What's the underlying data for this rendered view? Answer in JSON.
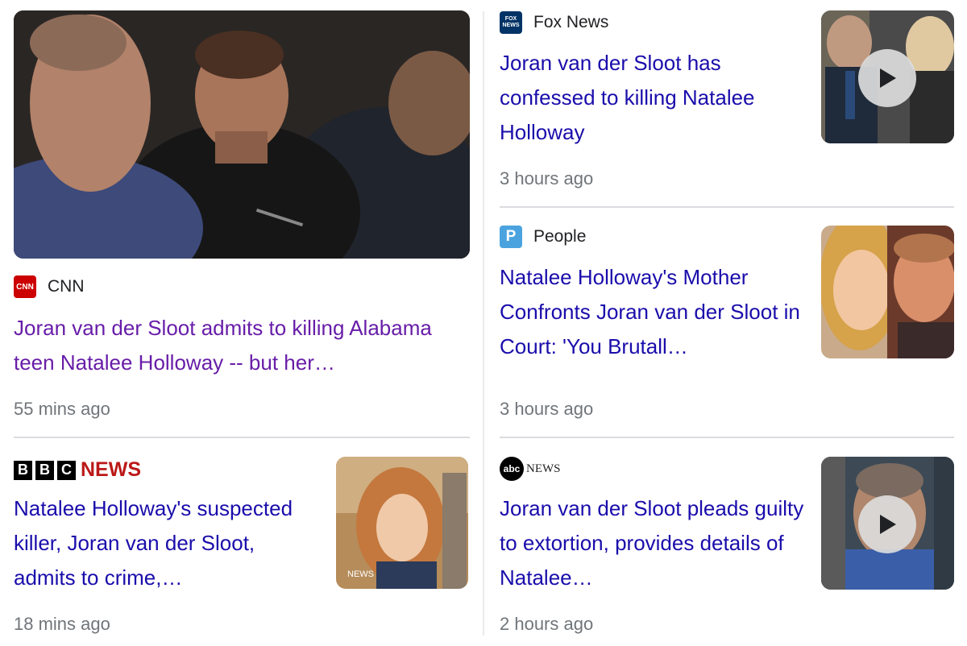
{
  "articles": [
    {
      "source": "CNN",
      "headline": "Joran van der Sloot admits to killing Alabama teen Natalee Holloway -- but her…",
      "time": "55 mins ago",
      "has_video": false,
      "visited": true,
      "logo_icon": "cnn-logo-icon",
      "logo_text": "CNN",
      "logo_color": "#cc0000"
    },
    {
      "source": "Fox News",
      "headline": "Joran van der Sloot has confessed to killing Natalee Holloway",
      "time": "3 hours ago",
      "has_video": true,
      "logo_icon": "fox-news-logo-icon",
      "logo_text": "FOX NEWS",
      "logo_color": "#003366"
    },
    {
      "source": "People",
      "headline": "Natalee Holloway's Mother Confronts Joran van der Sloot in Court: 'You Brutall…",
      "time": "3 hours ago",
      "has_video": false,
      "logo_icon": "people-logo-icon",
      "logo_text": "P",
      "logo_color": "#4aa3df"
    },
    {
      "source": "BBC NEWS",
      "source_letters": [
        "B",
        "B",
        "C"
      ],
      "source_word": "NEWS",
      "headline": "Natalee Holloway's suspected killer, Joran van der Sloot, admits to crime,…",
      "time": "18 mins ago",
      "has_video": false,
      "thumb_watermark": "NEWS",
      "logo_color": "#bb1919"
    },
    {
      "source": "abcNEWS",
      "source_mark": "abc",
      "source_word": "NEWS",
      "headline": "Joran van der Sloot pleads guilty to extortion, provides details of Natalee…",
      "time": "2 hours ago",
      "has_video": true,
      "logo_icon": "abc-news-logo-icon"
    }
  ],
  "colors": {
    "link": "#1a0dab",
    "visited": "#681da8",
    "meta": "#70757a",
    "divider": "#dadce0"
  }
}
